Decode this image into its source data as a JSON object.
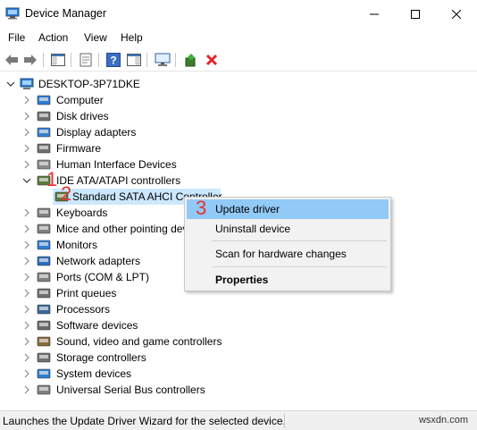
{
  "window": {
    "title": "Device Manager"
  },
  "menu": [
    "File",
    "Action",
    "View",
    "Help"
  ],
  "tree": {
    "root": "DESKTOP-3P71DKE",
    "items": [
      "Computer",
      "Disk drives",
      "Display adapters",
      "Firmware",
      "Human Interface Devices",
      "IDE ATA/ATAPI controllers",
      "Standard SATA AHCI Controller",
      "Keyboards",
      "Mice and other pointing devices",
      "Monitors",
      "Network adapters",
      "Ports (COM & LPT)",
      "Print queues",
      "Processors",
      "Software devices",
      "Sound, video and game controllers",
      "Storage controllers",
      "System devices",
      "Universal Serial Bus controllers"
    ]
  },
  "context_menu": {
    "update": "Update driver",
    "uninstall": "Uninstall device",
    "scan": "Scan for hardware changes",
    "properties": "Properties"
  },
  "annotations": {
    "step1": "1",
    "step2": "2",
    "step3": "3"
  },
  "status": {
    "text": "Launches the Update Driver Wizard for the selected device.",
    "watermark": "wsxdn.com"
  },
  "colors": {
    "selection": "#cce8ff",
    "menu_highlight": "#91c9f7",
    "annotation": "#e8322f",
    "delete": "#e0262b"
  }
}
